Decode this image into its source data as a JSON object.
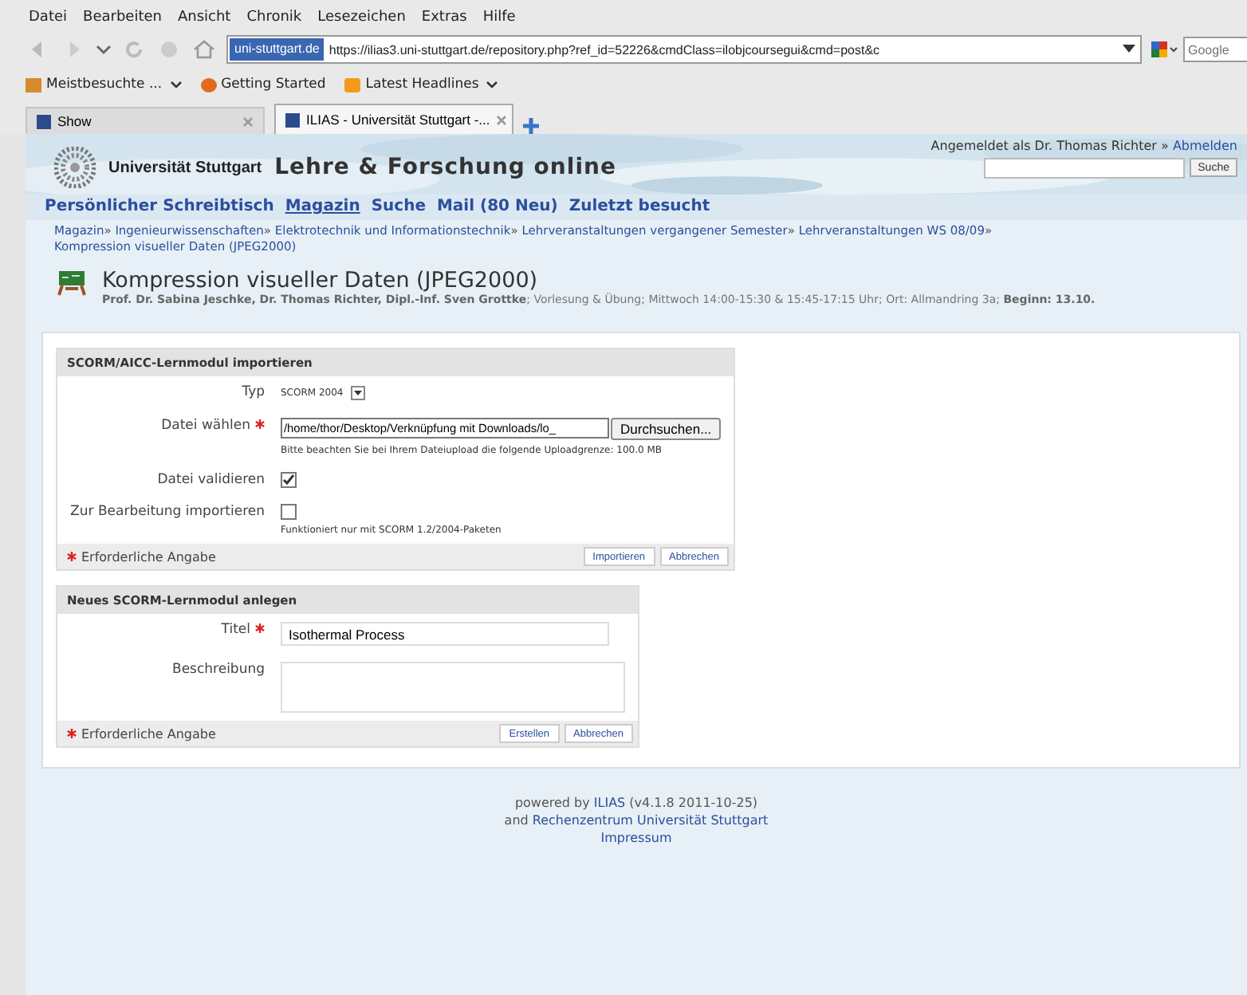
{
  "menu_bar": [
    "Datei",
    "Bearbeiten",
    "Ansicht",
    "Chronik",
    "Lesezeichen",
    "Extras",
    "Hilfe"
  ],
  "toolbar": {
    "site_badge": "uni-stuttgart.de",
    "url": "https://ilias3.uni-stuttgart.de/repository.php?ref_id=52226&cmdClass=ilobjcoursegui&cmd=post&c",
    "search_placeholder": "Google"
  },
  "bookmarks": [
    {
      "label": "Meistbesuchte ...",
      "kind": "folder"
    },
    {
      "label": "Getting Started",
      "kind": "firefox"
    },
    {
      "label": "Latest Headlines",
      "kind": "feed"
    }
  ],
  "tabs": [
    {
      "label": "Show",
      "selected": false
    },
    {
      "label": "ILIAS - Universität Stuttgart -...",
      "selected": true
    }
  ],
  "header": {
    "university": "Universität Stuttgart",
    "site_title": "Lehre & Forschung online",
    "login_text": "Angemeldet als Dr. Thomas Richter »",
    "logout": "Abmelden",
    "search_button": "Suche"
  },
  "nav": [
    {
      "label": "Persönlicher Schreibtisch",
      "selected": false
    },
    {
      "label": "Magazin",
      "selected": true
    },
    {
      "label": "Suche",
      "selected": false
    },
    {
      "label": "Mail (80 Neu)",
      "selected": false
    },
    {
      "label": "Zuletzt besucht",
      "selected": false
    }
  ],
  "breadcrumbs": [
    {
      "label": "Magazin"
    },
    {
      "separator": "»",
      "label": "Ingenieurwissenschaften"
    },
    {
      "separator": "»",
      "label": "Elektrotechnik und Informationstechnik"
    },
    {
      "separator": "»",
      "label": "Lehrveranstaltungen vergangener Semester"
    },
    {
      "separator": "»",
      "label": "Lehrveranstaltungen WS 08/09"
    },
    {
      "separator": "»",
      "label": "Kompression visueller Daten (JPEG2000)"
    }
  ],
  "course": {
    "title": "Kompression visueller Daten (JPEG2000)",
    "info": "**Prof. Dr. Sabina Jeschke, Dr. Thomas Richter, Dipl.-Inf. Sven Grottke**; Vorlesung & Übung; Mittwoch 14:00-15:30 & 15:45-17:15 Uhr; Ort: Allmandring 3a; **Beginn: 13.10.**"
  },
  "import_form": {
    "title": "SCORM/AICC-Lernmodul importieren",
    "rows": [
      {
        "kind": "select",
        "label": "Typ",
        "required": false,
        "value": "SCORM 2004"
      },
      {
        "kind": "file",
        "label": "Datei wählen",
        "required": true,
        "value": "/home/thor/Desktop/Verknüpfung mit Downloads/lo_",
        "button": "Durchsuchen...",
        "hint": "Bitte beachten Sie bei Ihrem Dateiupload die folgende Uploadgrenze: 100.0 MB"
      },
      {
        "kind": "checkbox",
        "label": "Datei validieren",
        "required": false,
        "checked": true
      },
      {
        "kind": "checkbox",
        "label": "Zur Bearbeitung importieren",
        "required": false,
        "checked": false,
        "hint": "Funktioniert nur mit SCORM 1.2/2004-Paketen"
      }
    ],
    "required_note": "Erforderliche Angabe",
    "buttons": [
      "Importieren",
      "Abbrechen"
    ]
  },
  "create_form": {
    "title": "Neues SCORM-Lernmodul anlegen",
    "rows": [
      {
        "kind": "text",
        "label": "Titel",
        "required": true,
        "value": "Isothermal Process"
      },
      {
        "kind": "textarea",
        "label": "Beschreibung",
        "required": false,
        "value": ""
      }
    ],
    "required_note": "Erforderliche Angabe",
    "buttons": [
      "Erstellen",
      "Abbrechen"
    ]
  },
  "footer": {
    "powered_by": "powered by",
    "ilias_link": "ILIAS",
    "version": "(v4.1.8 2011-10-25)",
    "and": "and",
    "rz_link": "Rechenzentrum Universität Stuttgart",
    "impressum": "Impressum"
  }
}
